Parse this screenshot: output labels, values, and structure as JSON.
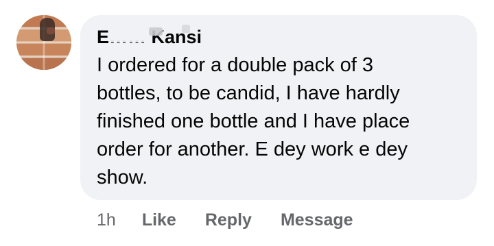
{
  "comment": {
    "author": "E…… Kansi",
    "body_lines": [
      "I ordered for a double pack of 3",
      "bottles, to be candid, I have hardly",
      "finished one bottle and I have place",
      "order for another. E dey work e dey",
      "show."
    ],
    "timestamp": "1h",
    "actions": {
      "like": "Like",
      "reply": "Reply",
      "message": "Message"
    }
  },
  "colors": {
    "bubble_bg": "#f0f2f5",
    "text": "#050505",
    "secondary_text": "#65676b"
  }
}
